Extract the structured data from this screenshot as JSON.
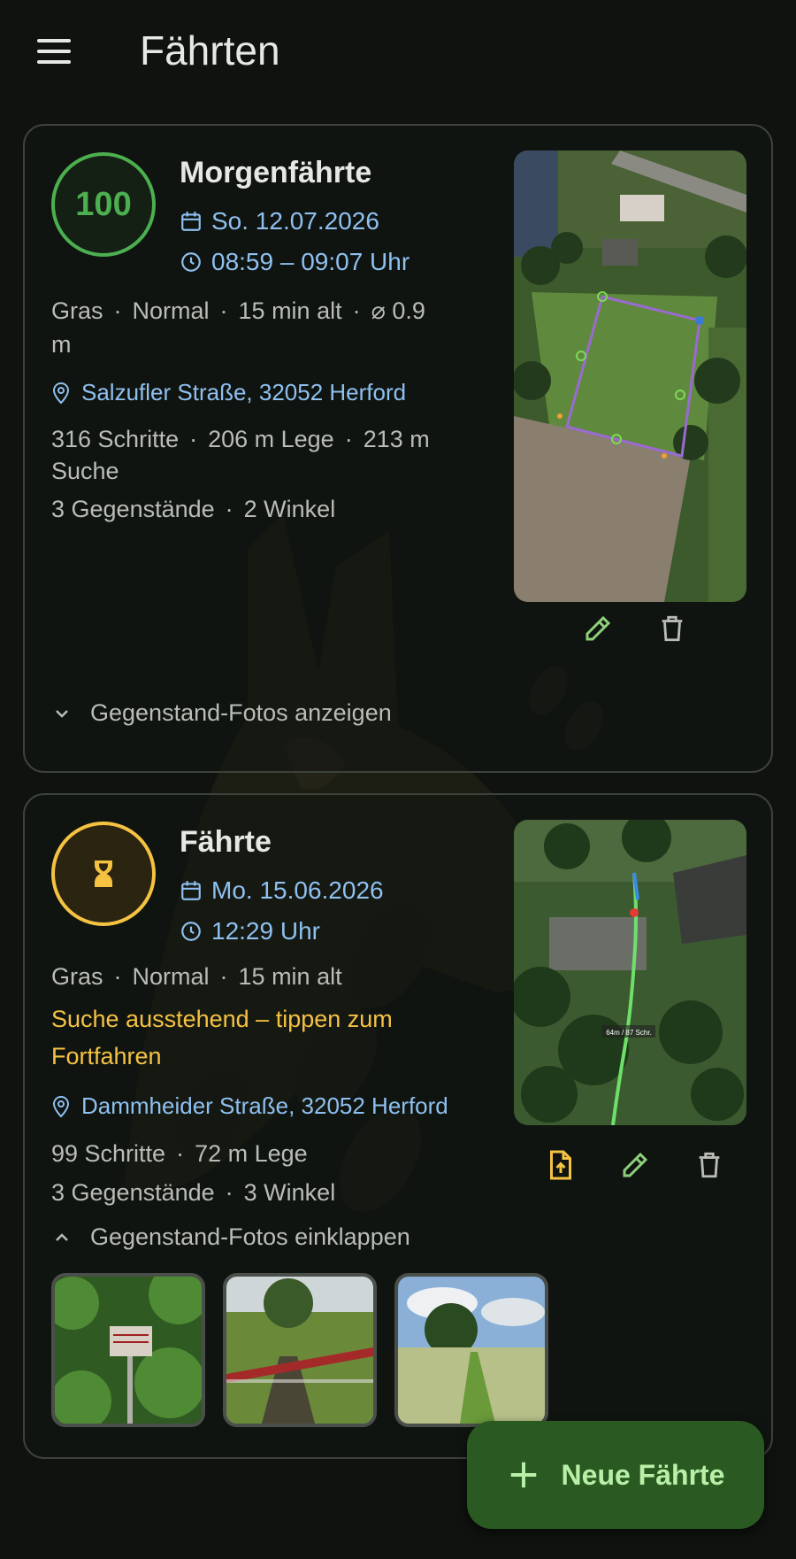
{
  "app": {
    "title": "Fährten"
  },
  "colors": {
    "background": "#0f120f",
    "accent_blue": "#8ec0f0",
    "accent_green": "#4caf50",
    "accent_amber": "#f5c242",
    "fab_bg": "#2a5a22"
  },
  "tracks": [
    {
      "score": "100",
      "title": "Morgenfährte",
      "date": "So. 12.07.2026",
      "time": "08:59 – 09:07 Uhr",
      "conditions_line1": "Gras",
      "conditions_line2": "Normal",
      "conditions_line3": "15 min alt",
      "conditions_line4": "⌀ 0.9",
      "conditions_unit": "m",
      "location": "Salzufler Straße, 32052 Herford",
      "stats_steps": "316 Schritte",
      "stats_lay": "206 m Lege",
      "stats_search": "213 m",
      "stats_search_label": "Suche",
      "items": "3 Gegenstände",
      "angles": "2 Winkel",
      "photos_toggle": "Gegenstand-Fotos anzeigen"
    },
    {
      "status": "pending",
      "title": "Fährte",
      "date": "Mo. 15.06.2026",
      "time": "12:29 Uhr",
      "conditions_line1": "Gras",
      "conditions_line2": "Normal",
      "conditions_line3": "15 min alt",
      "pending_text_line1": "Suche ausstehend – tippen zum",
      "pending_text_line2": "Fortfahren",
      "location": "Dammheider Straße, 32052 Herford",
      "stats_steps": "99 Schritte",
      "stats_lay": "72 m Lege",
      "items": "3 Gegenstände",
      "angles": "3 Winkel",
      "photos_toggle": "Gegenstand-Fotos einklappen",
      "map_label": "64m / 87 Schr."
    }
  ],
  "fab": {
    "label": "Neue Fährte"
  },
  "icons": [
    "menu-icon",
    "calendar-icon",
    "clock-icon",
    "location-pin-icon",
    "edit-icon",
    "delete-icon",
    "upload-file-icon",
    "chevron-down-icon",
    "chevron-up-icon",
    "hourglass-icon",
    "plus-icon"
  ]
}
